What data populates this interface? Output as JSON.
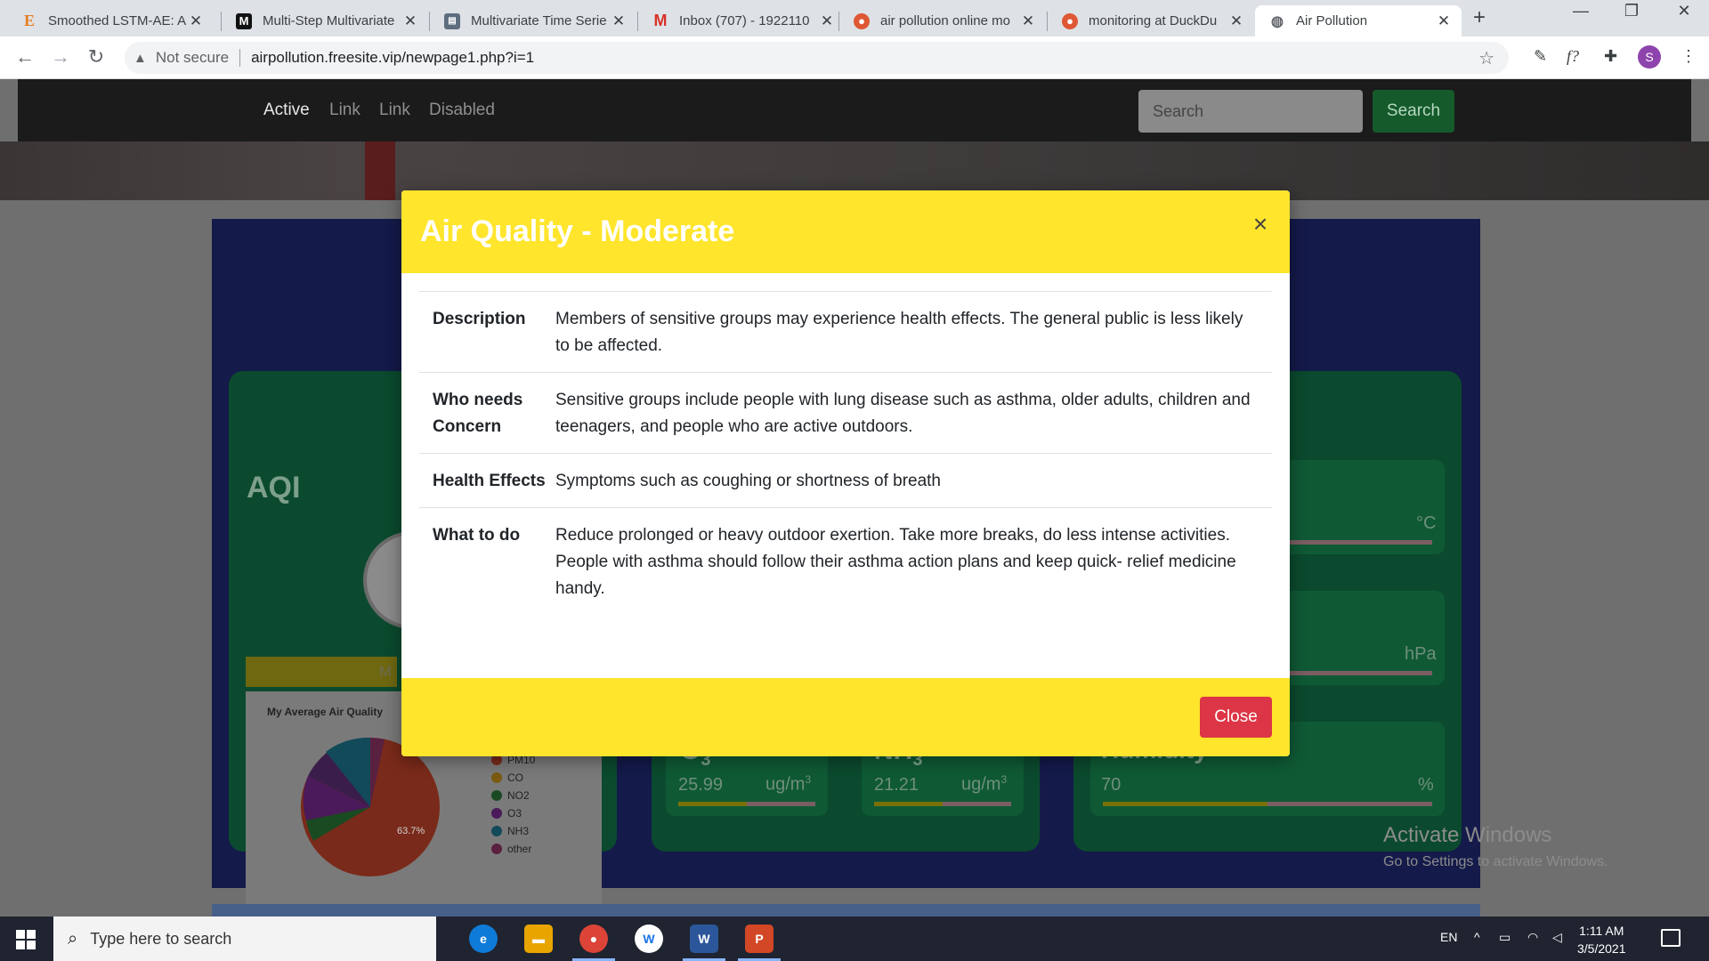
{
  "browser": {
    "tabs": [
      {
        "title": "Smoothed LSTM-AE: A",
        "icon": "E"
      },
      {
        "title": "Multi-Step Multivariate",
        "icon": "M"
      },
      {
        "title": "Multivariate Time Serie",
        "icon": "doc"
      },
      {
        "title": "Inbox (707) - 1922110",
        "icon": "M"
      },
      {
        "title": "air pollution online mo",
        "icon": "duck"
      },
      {
        "title": "monitoring at DuckDu",
        "icon": "duck"
      },
      {
        "title": "Air Pollution",
        "icon": "globe"
      }
    ],
    "not_secure": "Not secure",
    "url": "airpollution.freesite.vip/newpage1.php?i=1",
    "profile_initial": "S"
  },
  "navbar": {
    "links": [
      "Active",
      "Link",
      "Link",
      "Disabled"
    ],
    "search_placeholder": "Search",
    "search_button": "Search"
  },
  "dashboard": {
    "aqi_title": "AQI",
    "aqi_band_text": "M",
    "pie": {
      "title": "My Average Air Quality",
      "slice_label": "63.7%",
      "legend": [
        {
          "label": "PM10",
          "color": "#c0392b"
        },
        {
          "label": "CO",
          "color": "#d68910"
        },
        {
          "label": "NO2",
          "color": "#1e8449"
        },
        {
          "label": "O3",
          "color": "#7d3c98"
        },
        {
          "label": "NH3",
          "color": "#2471a3"
        },
        {
          "label": "other",
          "color": "#c0394f"
        }
      ]
    },
    "cards": [
      {
        "name": "O3",
        "title": "O",
        "sub": "3",
        "value": "25.99",
        "unit": "ug/m",
        "unit_sup": "3",
        "fill_percent": 50
      },
      {
        "name": "NH3",
        "title": "NH",
        "sub": "3",
        "value": "21.21",
        "unit": "ug/m",
        "unit_sup": "3",
        "fill_percent": 50
      },
      {
        "name": "humidity",
        "title": "Humidity",
        "value": "70",
        "unit": "%",
        "fill_percent": 50
      }
    ],
    "temp_unit": "°C",
    "pressure_unit": "hPa"
  },
  "modal": {
    "title": "Air Quality - Moderate",
    "rows": [
      {
        "label": "Description",
        "text": "Members of sensitive groups may experience health effects. The general public is less likely to be affected."
      },
      {
        "label": "Who needs Concern",
        "text": "Sensitive groups include people with lung disease such as asthma, older adults, children and teenagers, and people who are active outdoors."
      },
      {
        "label": "Health Effects",
        "text": "Symptoms such as coughing or shortness of breath"
      },
      {
        "label": "What to do",
        "text": "Reduce prolonged or heavy outdoor exertion. Take more breaks, do less intense activities. People with asthma should follow their asthma action plans and keep quick- relief medicine handy."
      }
    ],
    "close_button": "Close",
    "header_color": "#ffe52c",
    "close_color": "#dc3545"
  },
  "windows": {
    "watermark_title": "Activate Windows",
    "watermark_sub": "Go to Settings to activate Windows.",
    "search_placeholder": "Type here to search",
    "lang": "EN",
    "time": "1:11 AM",
    "date": "3/5/2021"
  }
}
